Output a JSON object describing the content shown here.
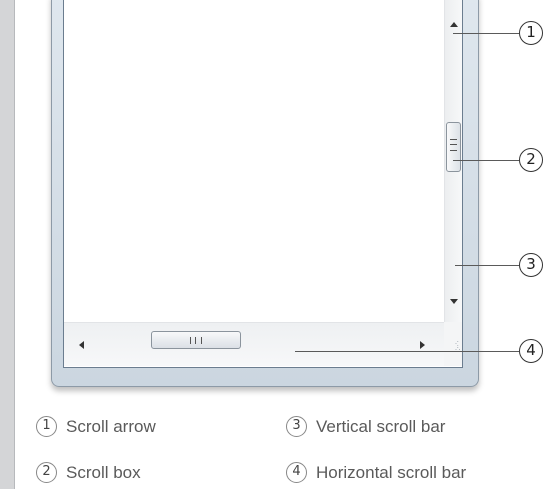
{
  "callouts": {
    "c1": "1",
    "c2": "2",
    "c3": "3",
    "c4": "4"
  },
  "legend": {
    "items": [
      {
        "number": "1",
        "label": "Scroll arrow"
      },
      {
        "number": "2",
        "label": "Scroll box"
      },
      {
        "number": "3",
        "label": "Vertical scroll bar"
      },
      {
        "number": "4",
        "label": "Horizontal scroll bar"
      }
    ]
  },
  "icons": {
    "scroll_up": "triangle-up",
    "scroll_down": "triangle-down",
    "scroll_left": "triangle-left",
    "scroll_right": "triangle-right",
    "grip": "resize-grip"
  },
  "colors": {
    "background": "#d4d5d7",
    "panel": "#ffffff",
    "window_frame": "#cbd6e0",
    "callout_line": "#5a5a5a",
    "legend_text": "#5a5a5a"
  }
}
